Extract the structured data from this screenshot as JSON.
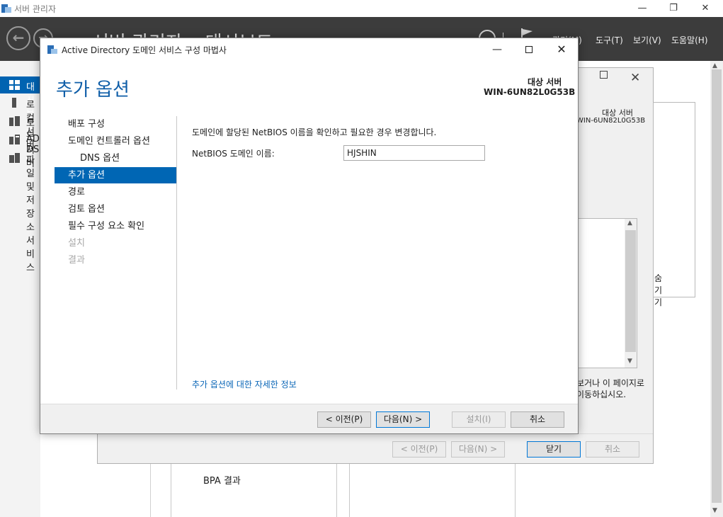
{
  "server_manager": {
    "title": "서버 관리자",
    "breadcrumb": "서버 관리자 • 대시보드",
    "menu": [
      "관리(M)",
      "도구(T)",
      "보기(V)",
      "도움말(H)"
    ],
    "sidebar": [
      {
        "label": "대시보드",
        "icon": "dashboard-icon"
      },
      {
        "label": "로컬 서버",
        "icon": "server-icon"
      },
      {
        "label": "모든 서버",
        "icon": "servers-icon"
      },
      {
        "label": "AD DS",
        "icon": "ad-icon"
      },
      {
        "label": "파일 및 저장소 서비스",
        "icon": "file-storage-icon"
      }
    ],
    "tile_label": "BPA 결과"
  },
  "behind_dialog": {
    "target_label": "대상 서버",
    "target_value": "WIN-6UN82L0G53B",
    "hide_label": "숨기기",
    "text": "보거나 이 페이지로 이동하십시오.",
    "buttons": {
      "prev": "< 이전(P)",
      "next": "다음(N) >",
      "close": "닫기",
      "cancel": "취소"
    }
  },
  "wizard": {
    "title": "Active Directory 도메인 서비스 구성 마법사",
    "heading": "추가 옵션",
    "target_label": "대상 서버",
    "target_value": "WIN-6UN82L0G53B",
    "nav": [
      {
        "label": "배포 구성",
        "state": "normal",
        "sub": false
      },
      {
        "label": "도메인 컨트롤러 옵션",
        "state": "normal",
        "sub": false
      },
      {
        "label": "DNS 옵션",
        "state": "normal",
        "sub": true
      },
      {
        "label": "추가 옵션",
        "state": "active",
        "sub": false
      },
      {
        "label": "경로",
        "state": "normal",
        "sub": false
      },
      {
        "label": "검토 옵션",
        "state": "normal",
        "sub": false
      },
      {
        "label": "필수 구성 요소 확인",
        "state": "normal",
        "sub": false
      },
      {
        "label": "설치",
        "state": "disabled",
        "sub": false
      },
      {
        "label": "결과",
        "state": "disabled",
        "sub": false
      }
    ],
    "description": "도메인에 할당된 NetBIOS 이름을 확인하고 필요한 경우 변경합니다.",
    "field_label": "NetBIOS 도메인 이름:",
    "field_value": "HJSHIN",
    "more_info": "추가 옵션에 대한 자세한 정보",
    "buttons": {
      "prev": "< 이전(P)",
      "next": "다음(N) >",
      "install": "설치(I)",
      "cancel": "취소"
    }
  }
}
